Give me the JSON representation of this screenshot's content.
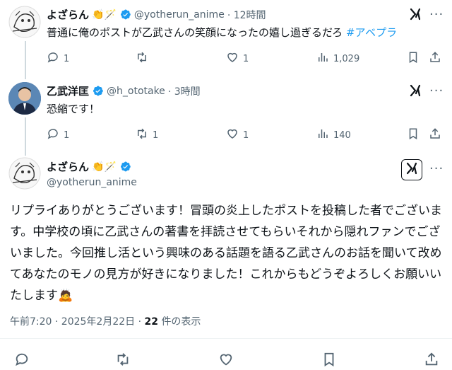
{
  "tweet1": {
    "name": "よざらん",
    "emojis": "👏🪄",
    "handle": "@yotherun_anime",
    "time": "· 12時間",
    "text": "普通に俺のポストが乙武さんの笑顔になったの嬉し過ぎるだろ",
    "hashtag": "#アベプラ",
    "replies": "1",
    "retweets": "",
    "likes": "1",
    "views": "1,029"
  },
  "tweet2": {
    "name": "乙武洋匡",
    "handle": "@h_ototake",
    "time": "· 3時間",
    "text": "恐縮です！",
    "replies": "1",
    "retweets": "1",
    "likes": "1",
    "views": "140"
  },
  "main": {
    "name": "よざらん",
    "emojis": "👏🪄",
    "handle": "@yotherun_anime",
    "text": "リプライありがとうございます！冒頭の炎上したポストを投稿した者でございます。中学校の頃に乙武さんの著書を拝読させてもらいそれから隠れファンでございました。今回推し活という興味のある話題を語る乙武さんのお話を聞いて改めてあなたのモノの見方が好きになりました！これからもどうぞよろしくお願いいたします🙇",
    "date": "午前7:20 · 2025年2月22日 ·",
    "views_count": "22",
    "views_label": "件の表示"
  },
  "colors": {
    "accent": "#1d9bf0",
    "muted": "#536471",
    "text": "#0f1419"
  },
  "icons": [
    "reply-icon",
    "retweet-icon",
    "like-icon",
    "views-icon",
    "bookmark-icon",
    "share-icon",
    "grok-icon",
    "verified-icon",
    "more-icon"
  ]
}
